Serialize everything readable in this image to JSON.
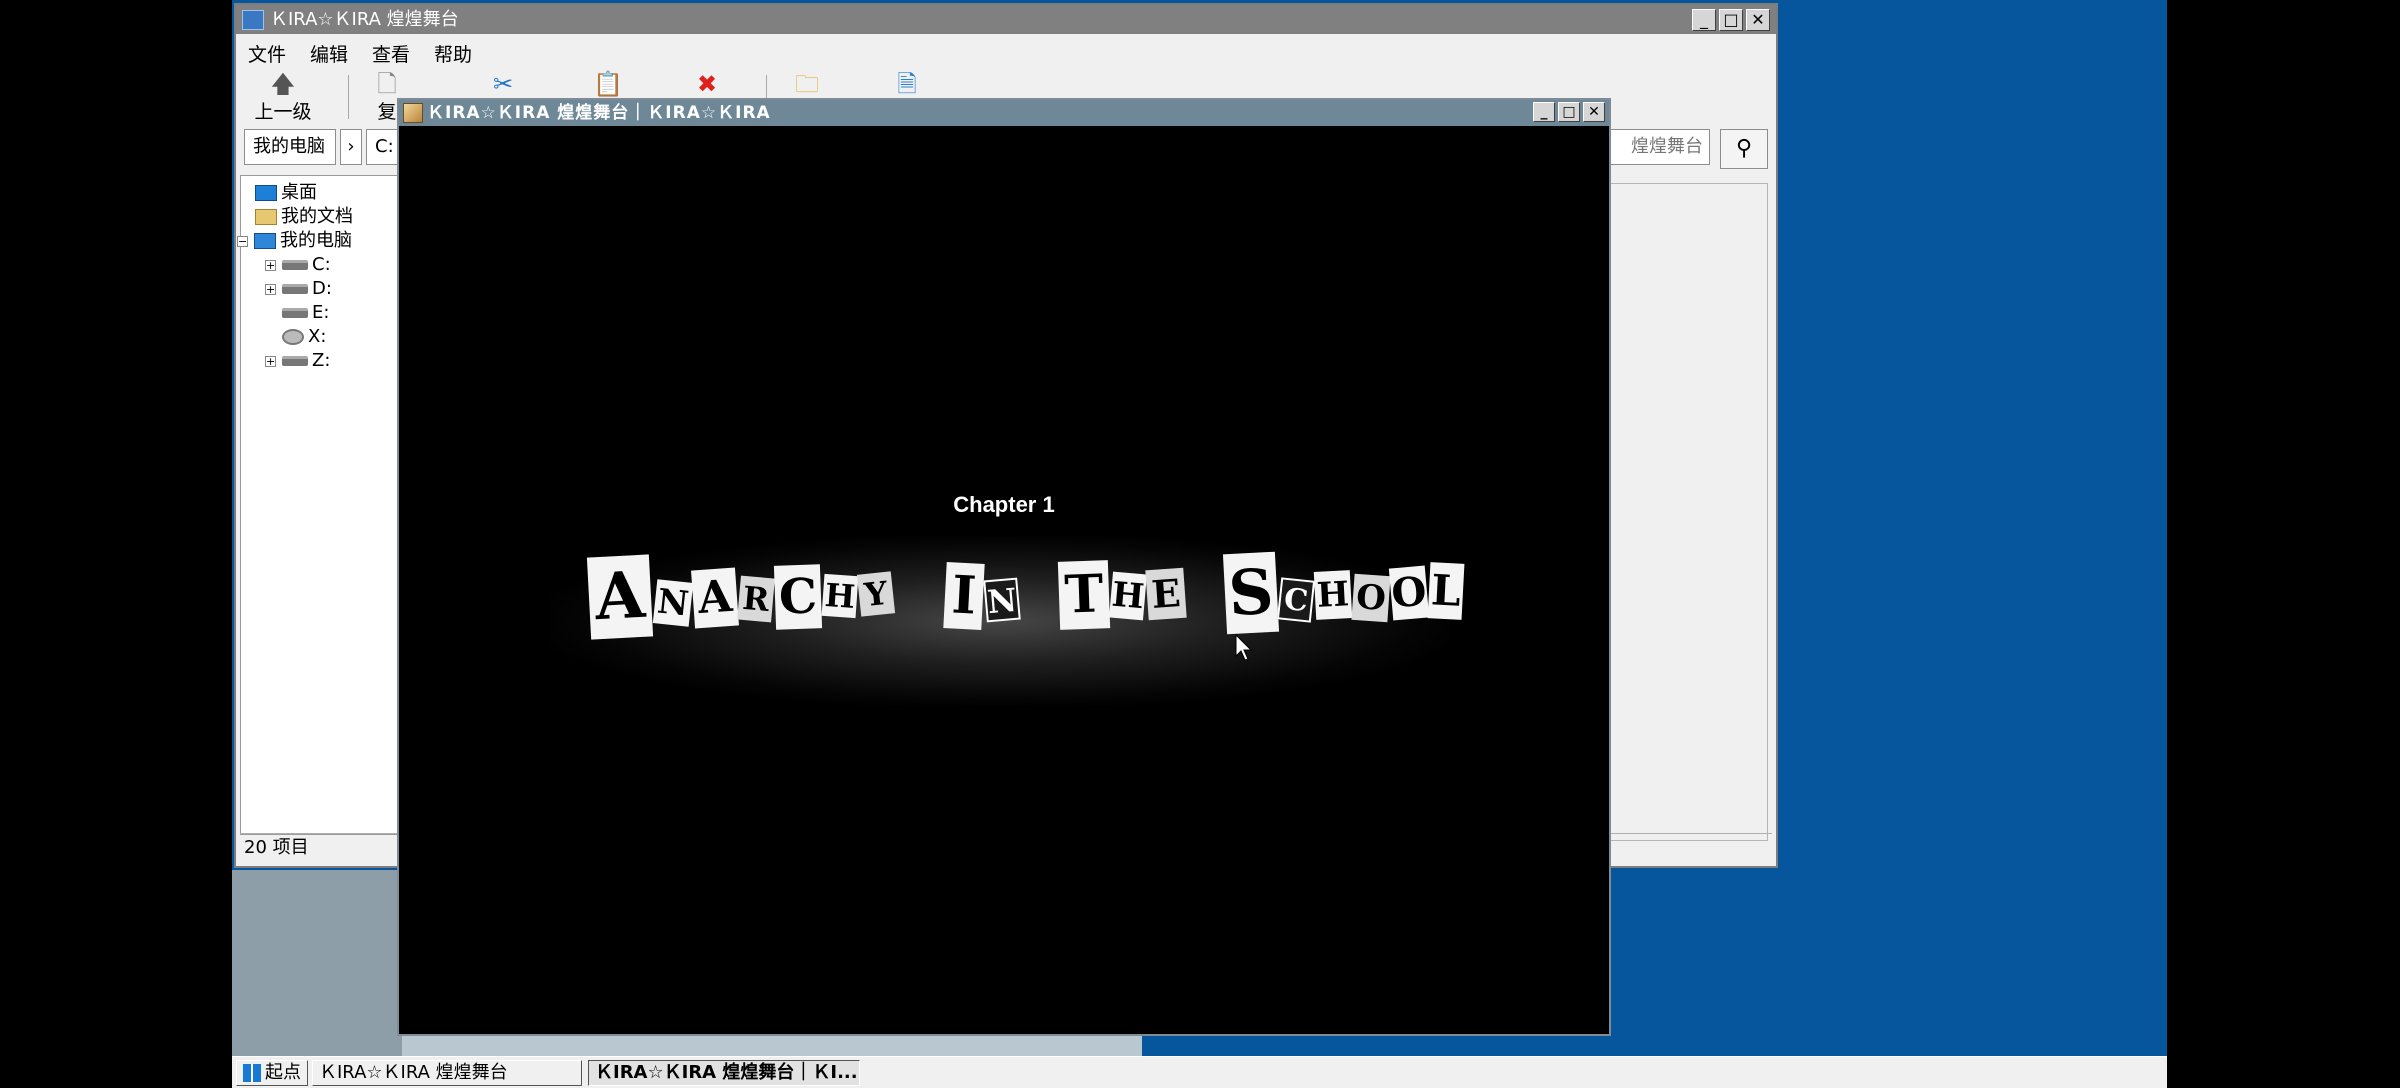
{
  "explorer": {
    "title": "ＫIRA☆ＫIRA 煌煌舞台",
    "menus": [
      "文件",
      "编辑",
      "查看",
      "帮助"
    ],
    "toolbar": {
      "up_label": "上一级",
      "copy_label_partial": "复"
    },
    "address": {
      "crumb_root": "我的电脑",
      "crumb_drive": "C:",
      "search_text": "煌煌舞台"
    },
    "tree": {
      "desktop": "桌面",
      "documents": "我的文档",
      "computer": "我的电脑",
      "drives": [
        "C:",
        "D:",
        "E:",
        "X:",
        "Z:"
      ]
    },
    "status": "20 项目"
  },
  "game": {
    "title": "ＫIRA☆ＫIRA 煌煌舞台｜ＫIRA☆ＫIRA",
    "chapter": "Chapter 1",
    "logo_text": "ANARCHY IN THE SCHOOL"
  },
  "taskbar": {
    "start_label": "起点",
    "tasks": [
      "ＫIRA☆ＫIRA 煌煌舞台",
      "ＫIRA☆ＫIRA 煌煌舞台｜ＫI..."
    ]
  },
  "colors": {
    "desktop": "#06569e",
    "titlebar_explorer": "#808080",
    "titlebar_game": "#6e8898",
    "delete_red": "#e0201b",
    "cut_blue": "#1e73c8"
  }
}
